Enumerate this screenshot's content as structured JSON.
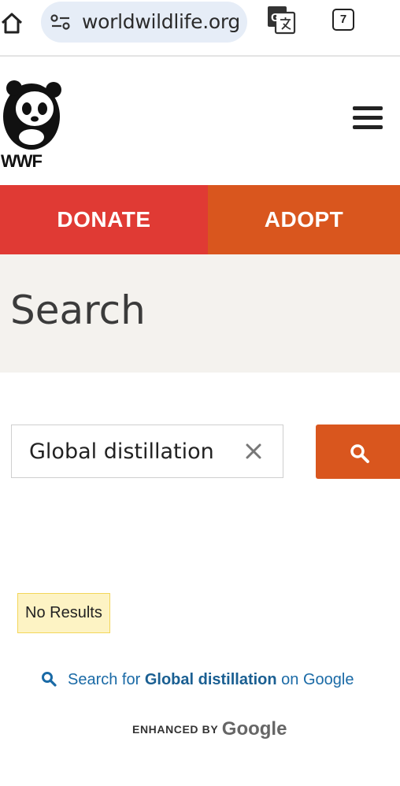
{
  "browser": {
    "url": "worldwildlife.org",
    "tab_count": "7",
    "icons": [
      "home-icon",
      "site-settings-icon",
      "translate-icon",
      "tabs-icon"
    ]
  },
  "header": {
    "logo_text": "WWF",
    "menu_icon": "hamburger-menu-icon"
  },
  "cta": {
    "donate_label": "DONATE",
    "adopt_label": "ADOPT",
    "donate_color": "#e03a34",
    "adopt_color": "#d9561e"
  },
  "page": {
    "title": "Search"
  },
  "search": {
    "query": "Global distillation",
    "clear_icon": "close-icon",
    "submit_icon": "search-icon"
  },
  "results": {
    "empty_message": "No Results",
    "google_prefix": "Search for ",
    "google_query": "Global distillation",
    "google_suffix": " on Google",
    "enhanced_prefix": "ENHANCED BY",
    "enhanced_brand": "Google"
  }
}
